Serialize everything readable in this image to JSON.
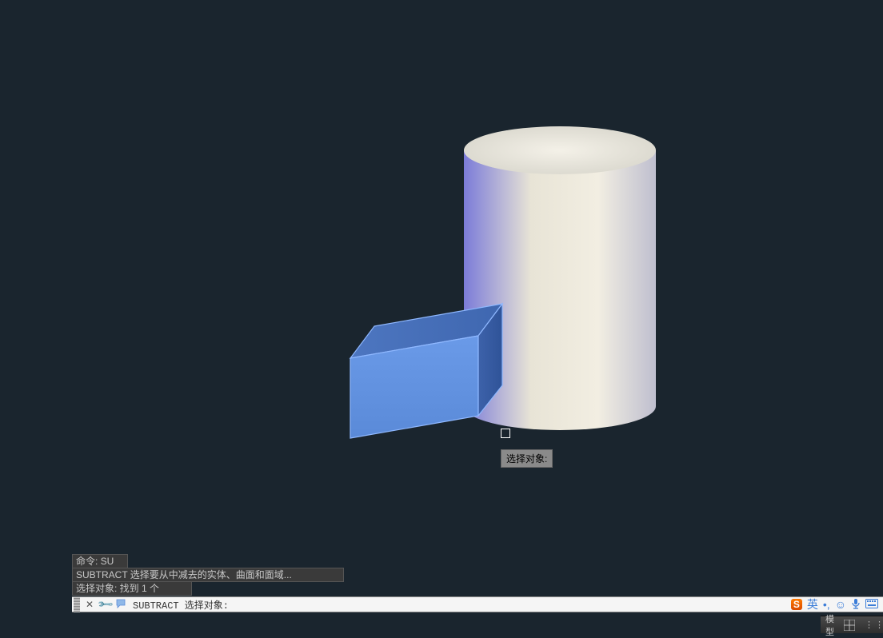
{
  "tooltip": {
    "text": "选择对象:"
  },
  "history": {
    "line1": "命令: SU",
    "line2": "SUBTRACT 选择要从中减去的实体、曲面和面域...",
    "line3": "选择对象: 找到 1 个"
  },
  "commandLine": {
    "text": "SUBTRACT 选择对象:"
  },
  "ime": {
    "badge": "S",
    "lang": "英"
  },
  "status": {
    "model": "模型"
  }
}
